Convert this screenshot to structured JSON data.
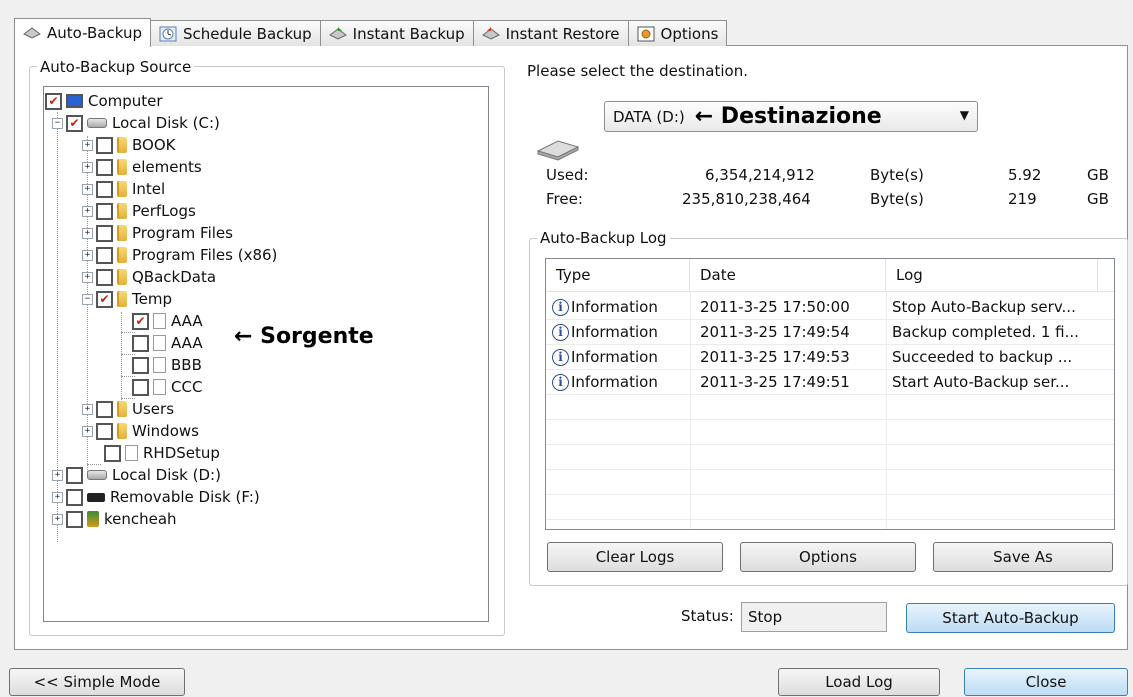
{
  "tabs": [
    {
      "label": "Auto-Backup",
      "icon": "auto-backup-icon",
      "active": true
    },
    {
      "label": "Schedule Backup",
      "icon": "clock-icon"
    },
    {
      "label": "Instant Backup",
      "icon": "instant-backup-icon"
    },
    {
      "label": "Instant Restore",
      "icon": "instant-restore-icon"
    },
    {
      "label": "Options",
      "icon": "options-icon"
    }
  ],
  "source": {
    "group_label": "Auto-Backup Source",
    "annotation": "← Sorgente",
    "tree": [
      {
        "label": "Computer",
        "checked": "partial",
        "icon": "computer-icon"
      },
      {
        "label": "Local Disk (C:)",
        "checked": true,
        "icon": "drive-icon"
      },
      {
        "label": "BOOK",
        "checked": false,
        "icon": "folder-icon"
      },
      {
        "label": "elements",
        "checked": false,
        "icon": "folder-icon"
      },
      {
        "label": "Intel",
        "checked": false,
        "icon": "folder-icon"
      },
      {
        "label": "PerfLogs",
        "checked": false,
        "icon": "folder-icon"
      },
      {
        "label": "Program Files",
        "checked": false,
        "icon": "folder-icon"
      },
      {
        "label": "Program Files (x86)",
        "checked": false,
        "icon": "folder-icon"
      },
      {
        "label": "QBackData",
        "checked": false,
        "icon": "folder-icon"
      },
      {
        "label": "Temp",
        "checked": true,
        "icon": "folder-icon"
      },
      {
        "label": "AAA",
        "checked": true,
        "icon": "file-icon"
      },
      {
        "label": "AAA",
        "checked": false,
        "icon": "file-icon"
      },
      {
        "label": "BBB",
        "checked": false,
        "icon": "file-icon"
      },
      {
        "label": "CCC",
        "checked": false,
        "icon": "file-icon"
      },
      {
        "label": "Users",
        "checked": false,
        "icon": "folder-icon"
      },
      {
        "label": "Windows",
        "checked": false,
        "icon": "folder-icon"
      },
      {
        "label": "RHDSetup",
        "checked": false,
        "icon": "file-icon"
      },
      {
        "label": "Local Disk (D:)",
        "checked": false,
        "icon": "drive-icon"
      },
      {
        "label": "Removable Disk (F:)",
        "checked": false,
        "icon": "usb-drive-icon"
      },
      {
        "label": "kencheah",
        "checked": false,
        "icon": "user-folder-icon"
      }
    ]
  },
  "destination": {
    "prompt": "Please select the destination.",
    "selected": "DATA (D:)",
    "annotation": "← Destinazione",
    "used_label": "Used:",
    "used_bytes": "6,354,214,912",
    "used_unit": "Byte(s)",
    "used_gb": "5.92",
    "free_label": "Free:",
    "free_bytes": "235,810,238,464",
    "free_unit": "Byte(s)",
    "free_gb": "219",
    "gb_unit": "GB"
  },
  "log": {
    "group_label": "Auto-Backup Log",
    "columns": [
      "Type",
      "Date",
      "Log"
    ],
    "rows": [
      {
        "type": "Information",
        "date": "2011-3-25 17:50:00",
        "log": "Stop Auto-Backup serv..."
      },
      {
        "type": "Information",
        "date": "2011-3-25 17:49:54",
        "log": "Backup completed. 1 fi..."
      },
      {
        "type": "Information",
        "date": "2011-3-25 17:49:53",
        "log": "Succeeded to backup ..."
      },
      {
        "type": "Information",
        "date": "2011-3-25 17:49:51",
        "log": "Start Auto-Backup ser..."
      }
    ],
    "clear_label": "Clear Logs",
    "options_label": "Options",
    "save_label": "Save As"
  },
  "status": {
    "label": "Status:",
    "value": "Stop",
    "start_label": "Start Auto-Backup"
  },
  "footer": {
    "simple_mode_label": "<< Simple Mode",
    "load_log_label": "Load Log",
    "close_label": "Close"
  }
}
